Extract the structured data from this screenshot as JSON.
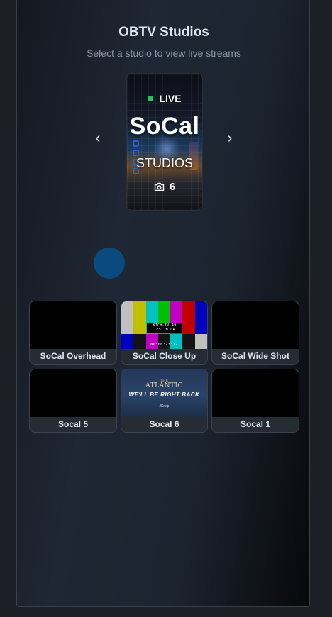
{
  "header": {
    "title": "OBTV Studios",
    "subtitle": "Select a studio to view live streams"
  },
  "carousel": {
    "prev_icon": "chevron-left-icon",
    "next_icon": "chevron-right-icon",
    "prev_glyph": "‹",
    "next_glyph": "›",
    "current": {
      "status": "LIVE",
      "status_color": "#22c55e",
      "brand_line1": "SoCal",
      "brand_line2": "STUDIOS",
      "camera_icon": "camera-icon",
      "camera_count": "6"
    }
  },
  "loading_indicator": {
    "color": "#0b4a7e"
  },
  "cameras": [
    {
      "label": "SoCal Overhead",
      "feed": "black"
    },
    {
      "label": "SoCal Close Up",
      "feed": "color-bars",
      "overlay_text": [
        "KTCH-TV 49",
        "TEST M CR"
      ],
      "timecode": "00:00:23:12"
    },
    {
      "label": "SoCal Wide Shot",
      "feed": "black"
    },
    {
      "label": "Socal 5",
      "feed": "black"
    },
    {
      "label": "Socal 6",
      "feed": "be-right-back",
      "slate": {
        "small": "THE",
        "big": "ATLANTIC",
        "main": "WE'LL BE RIGHT BACK",
        "logo": "JKrisp"
      }
    },
    {
      "label": "Socal 1",
      "feed": "black"
    }
  ],
  "colors": {
    "panel_border": "#3a404b",
    "tile_bg": "#262c34",
    "title": "#dfe5ee",
    "subtitle": "#8b96a8"
  }
}
